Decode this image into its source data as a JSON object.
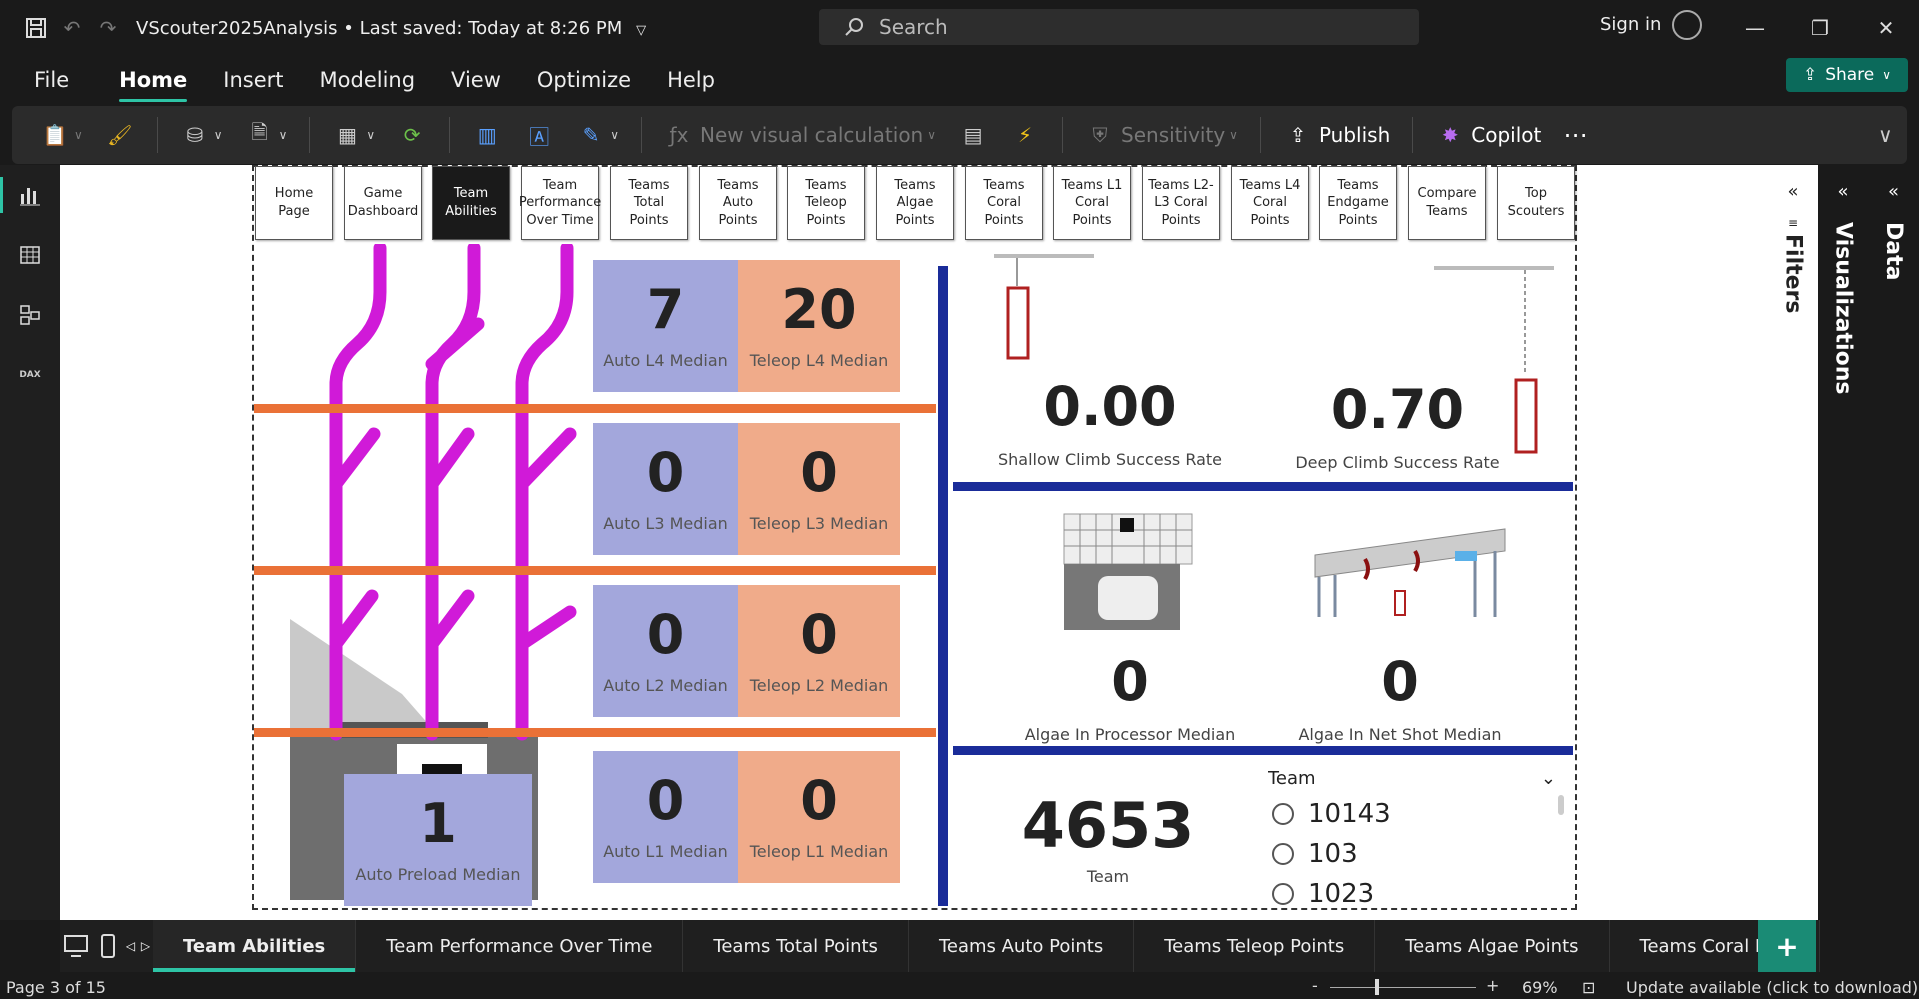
{
  "titlebar": {
    "file_name": "VScouter2025Analysis",
    "saved": "Last saved: Today at 8:26 PM",
    "search_placeholder": "Search",
    "sign_in": "Sign in"
  },
  "menu": {
    "items": [
      "File",
      "Home",
      "Insert",
      "Modeling",
      "View",
      "Optimize",
      "Help"
    ],
    "share": "Share"
  },
  "ribbon": {
    "new_visual_calc": "New visual calculation",
    "sensitivity": "Sensitivity",
    "publish": "Publish",
    "copilot": "Copilot"
  },
  "nav_buttons": [
    {
      "label": "Home Page"
    },
    {
      "label": "Game Dashboard"
    },
    {
      "label": "Team Abilities"
    },
    {
      "label": "Team Performance Over Time"
    },
    {
      "label": "Teams Total Points"
    },
    {
      "label": "Teams Auto Points"
    },
    {
      "label": "Teams Teleop Points"
    },
    {
      "label": "Teams Algae Points"
    },
    {
      "label": "Teams Coral Points"
    },
    {
      "label": "Teams L1 Coral Points"
    },
    {
      "label": "Teams L2-L3 Coral Points"
    },
    {
      "label": "Teams L4 Coral Points"
    },
    {
      "label": "Teams Endgame Points"
    },
    {
      "label": "Compare Teams"
    },
    {
      "label": "Top Scouters"
    }
  ],
  "kpis": {
    "auto_l4": {
      "value": "7",
      "label": "Auto L4 Median"
    },
    "teleop_l4": {
      "value": "20",
      "label": "Teleop L4 Median"
    },
    "auto_l3": {
      "value": "0",
      "label": "Auto L3 Median"
    },
    "teleop_l3": {
      "value": "0",
      "label": "Teleop L3 Median"
    },
    "auto_l2": {
      "value": "0",
      "label": "Auto L2 Median"
    },
    "teleop_l2": {
      "value": "0",
      "label": "Teleop L2 Median"
    },
    "auto_l1": {
      "value": "0",
      "label": "Auto L1 Median"
    },
    "teleop_l1": {
      "value": "0",
      "label": "Teleop L1 Median"
    },
    "auto_preload": {
      "value": "1",
      "label": "Auto Preload Median"
    }
  },
  "climb": {
    "shallow": {
      "value": "0.00",
      "label": "Shallow Climb Success Rate"
    },
    "deep": {
      "value": "0.70",
      "label": "Deep Climb Success Rate"
    }
  },
  "algae": {
    "processor": {
      "value": "0",
      "label": "Algae In Processor Median"
    },
    "net": {
      "value": "0",
      "label": "Algae In Net Shot Median"
    }
  },
  "team_card": {
    "value": "4653",
    "label": "Team"
  },
  "slicer": {
    "title": "Team",
    "options": [
      "10143",
      "103",
      "1023"
    ]
  },
  "panes": {
    "filters": "Filters",
    "visualizations": "Visualizations",
    "data": "Data"
  },
  "tabs": [
    "Team Abilities",
    "Team Performance Over Time",
    "Teams Total Points",
    "Teams Auto Points",
    "Teams Teleop Points",
    "Teams Algae Points",
    "Teams Coral Points"
  ],
  "status": {
    "page": "Page 3 of 15",
    "zoom": "69%",
    "update": "Update available (click to download)"
  },
  "colors": {
    "accent": "#2ec4a6",
    "kpi_blue": "#a3a7dc",
    "kpi_salmon": "#f0ab8a",
    "divider_blue": "#1a2c99",
    "level_orange": "#ea7137",
    "coral_magenta": "#d01ad8"
  }
}
